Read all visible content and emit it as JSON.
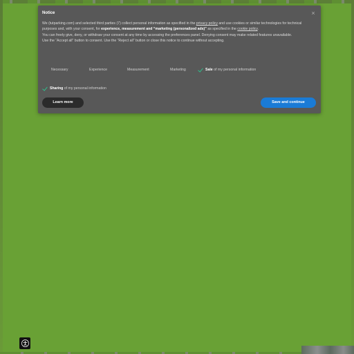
{
  "colors": {
    "background": "#69a135",
    "dialog": "#585858",
    "primary_button": "#1a7bd6",
    "secondary_button": "#2b2b2b",
    "check": "#2fbf8c"
  },
  "dialog": {
    "title": "Notice",
    "close_label": "×",
    "paragraph1": {
      "part1": "We (tutparking.com) and selected third parties (7) collect personal information as specified in the ",
      "privacy_link": "privacy policy",
      "part2": " and use cookies or similar technologies for technical purposes and, with your consent, for ",
      "bold": "experience, measurement and “marketing (personalized ads)”",
      "part3": " as specified in the ",
      "cookie_link": "cookie policy",
      "part4": "."
    },
    "paragraph2": "You can freely give, deny, or withdraw your consent at any time by accessing the preferences panel. Denying consent may make related features unavailable.",
    "paragraph3": "Use the “Accept all” button to consent. Use the “Reject all” button or close this notice to continue without accepting.",
    "choices": [
      {
        "label": "Necessary",
        "checked": false
      },
      {
        "label": "Experience",
        "checked": false
      },
      {
        "label": "Measurement",
        "checked": false
      },
      {
        "label": "Marketing",
        "checked": false
      },
      {
        "label_bold": "Sale",
        "label_rest": " of my personal information",
        "checked": true
      }
    ],
    "sharing": {
      "label_bold": "Sharing",
      "label_rest": " of my personal information",
      "checked": true
    },
    "learn_more": "Learn more",
    "save_continue": "Save and continue"
  },
  "accessibility_icon": "accessibility-icon"
}
